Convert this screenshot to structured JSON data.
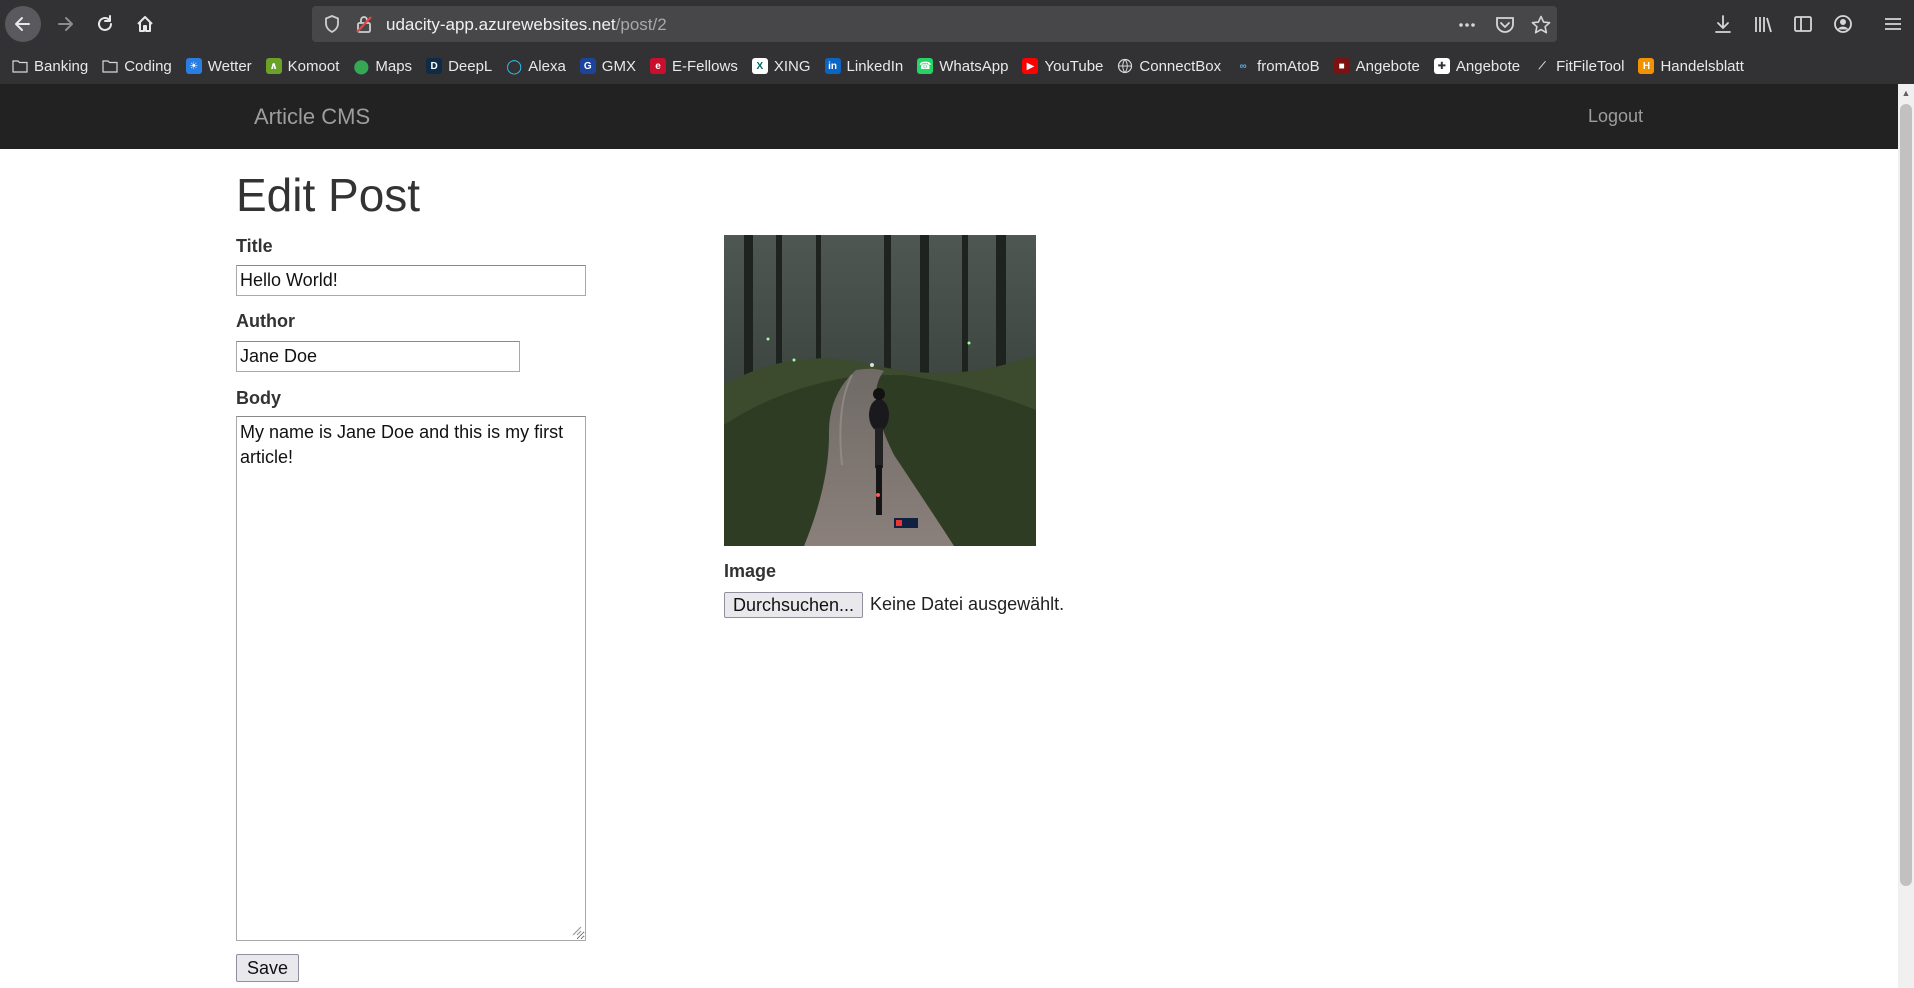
{
  "browser": {
    "url_host": "udacity-app.azurewebsites.net",
    "url_path": "/post/2",
    "bookmarks": [
      {
        "label": "Banking",
        "icon": "folder-icon"
      },
      {
        "label": "Coding",
        "icon": "folder-icon"
      },
      {
        "label": "Wetter",
        "icon": "weather-icon"
      },
      {
        "label": "Komoot",
        "icon": "komoot-icon"
      },
      {
        "label": "Maps",
        "icon": "maps-pin-icon"
      },
      {
        "label": "DeepL",
        "icon": "deepl-icon"
      },
      {
        "label": "Alexa",
        "icon": "alexa-icon"
      },
      {
        "label": "GMX",
        "icon": "gmx-icon"
      },
      {
        "label": "E-Fellows",
        "icon": "efellows-icon"
      },
      {
        "label": "XING",
        "icon": "xing-icon"
      },
      {
        "label": "LinkedIn",
        "icon": "linkedin-icon"
      },
      {
        "label": "WhatsApp",
        "icon": "whatsapp-icon"
      },
      {
        "label": "YouTube",
        "icon": "youtube-icon"
      },
      {
        "label": "ConnectBox",
        "icon": "globe-icon"
      },
      {
        "label": "fromAtoB",
        "icon": "fromatob-icon"
      },
      {
        "label": "Angebote",
        "icon": "angebote-icon"
      },
      {
        "label": "Angebote",
        "icon": "angebote-cross-icon"
      },
      {
        "label": "FitFileTool",
        "icon": "fitfiletool-icon"
      },
      {
        "label": "Handelsblatt",
        "icon": "handelsblatt-icon"
      }
    ]
  },
  "navbar": {
    "brand": "Article CMS",
    "logout": "Logout"
  },
  "form": {
    "heading": "Edit Post",
    "title_label": "Title",
    "title_value": "Hello World!",
    "author_label": "Author",
    "author_value": "Jane Doe",
    "body_label": "Body",
    "body_value": "My name is Jane Doe and this is my first article!",
    "image_label": "Image",
    "browse_label": "Durchsuchen...",
    "no_file_text": "Keine Datei ausgewählt.",
    "save_label": "Save"
  },
  "colors": {
    "chrome_bg": "#323234",
    "navbar_bg": "#222222",
    "navbar_text": "#9d9d9d"
  }
}
